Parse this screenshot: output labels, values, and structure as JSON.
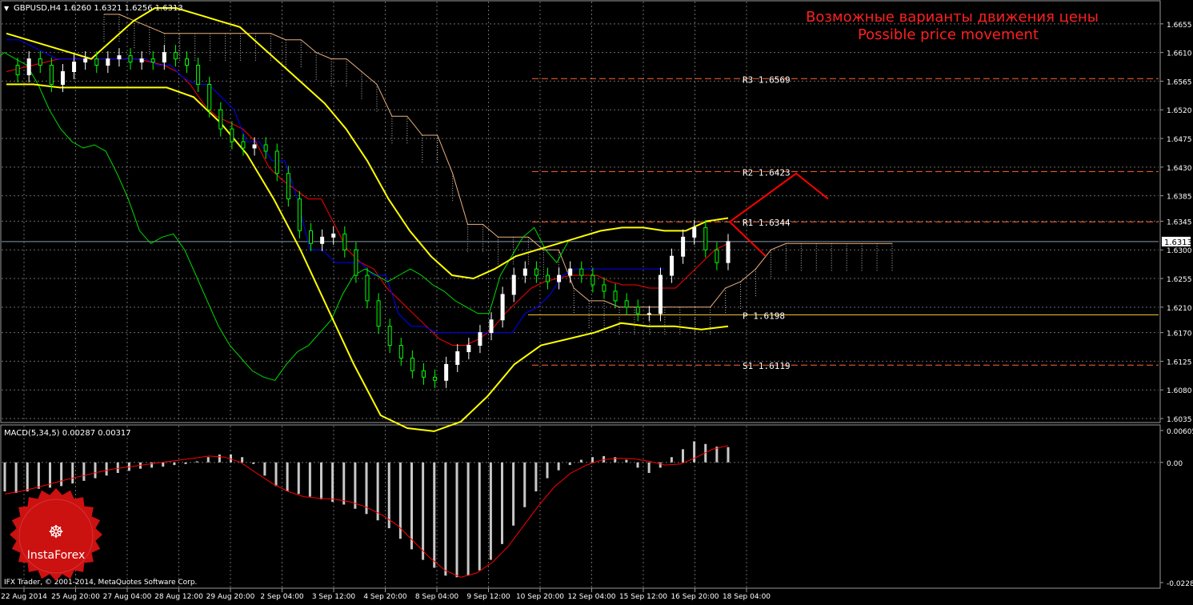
{
  "window": {
    "symbol_header": "GBPUSD,H4  1.6260 1.6321 1.6256 1.6313",
    "menu_arrow": "triangle-down-icon"
  },
  "overlay_title": {
    "ru": "Возможные варианты движения цены",
    "en": "Possible price movement",
    "color": "#ff2020"
  },
  "footer_copyright": "IFX Trader, © 2001-2014, MetaQuotes Software Corp.",
  "logo": {
    "text": "InstaForex",
    "color": "#cc1111"
  },
  "colors": {
    "grid": "#6b6b6b",
    "axis": "#9a9a9a",
    "label": "#ffffff",
    "candle_up": "#ffffff",
    "candle_down": "#00ff00",
    "tenkan": "#ff0000",
    "kijun": "#0000ff",
    "chikou": "#00dd00",
    "bollinger": "#ffff00",
    "level_line": "#ff6633",
    "pivot_line": "#ffcc33",
    "arrow": "#ff0000",
    "histogram": "#c8c8c8",
    "signal": "#ff0000"
  },
  "chart_data": [
    {
      "type": "candlestick",
      "title": "GBPUSD,H4",
      "current_price": "1.6313",
      "y_ticks": [
        "1.6655",
        "1.6610",
        "1.6565",
        "1.6520",
        "1.6475",
        "1.6430",
        "1.6385",
        "1.6345",
        "1.6300",
        "1.6255",
        "1.6210",
        "1.6170",
        "1.6125",
        "1.6080",
        "1.6035"
      ],
      "ylim": [
        1.603,
        1.669
      ],
      "x_ticks": [
        "22 Aug 2014",
        "25 Aug 20:00",
        "27 Aug 04:00",
        "28 Aug 12:00",
        "29 Aug 20:00",
        "2 Sep 04:00",
        "3 Sep 12:00",
        "4 Sep 20:00",
        "8 Sep 04:00",
        "9 Sep 12:00",
        "10 Sep 20:00",
        "12 Sep 04:00",
        "15 Sep 12:00",
        "16 Sep 20:00",
        "18 Sep 04:00"
      ],
      "levels": [
        {
          "label": "R3 1.6569",
          "value": 1.6569,
          "kind": "resistance"
        },
        {
          "label": "R2 1.6423",
          "value": 1.6423,
          "kind": "resistance"
        },
        {
          "label": "R1 1.6344",
          "value": 1.6344,
          "kind": "resistance"
        },
        {
          "label": "P 1.6198",
          "value": 1.6198,
          "kind": "pivot"
        },
        {
          "label": "S1 1.6119",
          "value": 1.6119,
          "kind": "support"
        }
      ],
      "close_series": [
        1.659,
        1.6575,
        1.66,
        1.659,
        1.656,
        1.658,
        1.6595,
        1.66,
        1.659,
        1.66,
        1.6605,
        1.6595,
        1.66,
        1.6595,
        1.661,
        1.66,
        1.659,
        1.656,
        1.652,
        1.649,
        1.647,
        1.646,
        1.6465,
        1.6455,
        1.642,
        1.638,
        1.633,
        1.631,
        1.632,
        1.6325,
        1.63,
        1.626,
        1.622,
        1.618,
        1.615,
        1.613,
        1.611,
        1.61,
        1.6095,
        1.612,
        1.614,
        1.615,
        1.617,
        1.619,
        1.623,
        1.626,
        1.627,
        1.626,
        1.625,
        1.626,
        1.627,
        1.626,
        1.6245,
        1.6235,
        1.622,
        1.621,
        1.62,
        1.62,
        1.626,
        1.629,
        1.632,
        1.6335,
        1.63,
        1.628,
        1.6313
      ],
      "tenkan": [
        1.658,
        1.6585,
        1.659,
        1.6595,
        1.66,
        1.66,
        1.66,
        1.66,
        1.66,
        1.66,
        1.66,
        1.6595,
        1.659,
        1.658,
        1.656,
        1.653,
        1.651,
        1.65,
        1.649,
        1.647,
        1.643,
        1.641,
        1.6395,
        1.638,
        1.638,
        1.634,
        1.63,
        1.628,
        1.627,
        1.624,
        1.622,
        1.62,
        1.618,
        1.616,
        1.615,
        1.615,
        1.616,
        1.6175,
        1.62,
        1.622,
        1.624,
        1.625,
        1.6255,
        1.626,
        1.626,
        1.626,
        1.625,
        1.6245,
        1.6245,
        1.624,
        1.624,
        1.624,
        1.626,
        1.628,
        1.63,
        1.631
      ],
      "kijun": [
        1.663,
        1.663,
        1.662,
        1.661,
        1.66,
        1.66,
        1.66,
        1.66,
        1.66,
        1.66,
        1.66,
        1.66,
        1.659,
        1.659,
        1.657,
        1.656,
        1.656,
        1.654,
        1.652,
        1.647,
        1.647,
        1.644,
        1.644,
        1.638,
        1.63,
        1.63,
        1.628,
        1.628,
        1.628,
        1.626,
        1.626,
        1.62,
        1.618,
        1.618,
        1.617,
        1.617,
        1.617,
        1.617,
        1.617,
        1.617,
        1.617,
        1.62,
        1.621,
        1.623,
        1.626,
        1.627,
        1.627,
        1.627,
        1.627,
        1.627,
        1.627,
        1.627,
        1.627
      ],
      "bollinger_upper": [
        1.664,
        1.663,
        1.662,
        1.661,
        1.66,
        1.663,
        1.666,
        1.668,
        1.668,
        1.667,
        1.666,
        1.665,
        1.662,
        1.659,
        1.656,
        1.653,
        1.649,
        1.644,
        1.638,
        1.633,
        1.629,
        1.626,
        1.6255,
        1.627,
        1.629,
        1.63,
        1.631,
        1.632,
        1.633,
        1.6335,
        1.6335,
        1.633,
        1.633,
        1.6345,
        1.635
      ],
      "bollinger_lower": [
        1.656,
        1.656,
        1.6555,
        1.6555,
        1.6555,
        1.6555,
        1.6555,
        1.654,
        1.65,
        1.645,
        1.638,
        1.63,
        1.621,
        1.612,
        1.604,
        1.602,
        1.6015,
        1.603,
        1.607,
        1.612,
        1.615,
        1.616,
        1.617,
        1.6185,
        1.618,
        1.618,
        1.6175,
        1.618
      ]
    },
    {
      "type": "histogram",
      "title": "MACD(5,34,5) 0.00287 0.00317",
      "y_ticks": [
        "0.00605",
        "0.00",
        "-0.02282"
      ],
      "ylim": [
        -0.02282,
        0.00605
      ],
      "values": [
        -0.0055,
        -0.0058,
        -0.0055,
        -0.005,
        -0.0048,
        -0.0045,
        -0.004,
        -0.0035,
        -0.003,
        -0.0025,
        -0.002,
        -0.0016,
        -0.0012,
        -0.001,
        -0.0008,
        -0.0005,
        -0.0003,
        0.0002,
        0.001,
        0.0015,
        0.0015,
        0.001,
        -0.0003,
        -0.0025,
        -0.0045,
        -0.0055,
        -0.006,
        -0.0065,
        -0.007,
        -0.0075,
        -0.008,
        -0.0088,
        -0.0098,
        -0.011,
        -0.0125,
        -0.0145,
        -0.0165,
        -0.0185,
        -0.02,
        -0.0215,
        -0.0218,
        -0.0215,
        -0.0205,
        -0.0185,
        -0.0155,
        -0.012,
        -0.0085,
        -0.0055,
        -0.003,
        -0.0015,
        -0.0005,
        0.0005,
        0.001,
        0.0012,
        0.001,
        0.0005,
        -0.001,
        -0.002,
        -0.001,
        0.001,
        0.0025,
        0.004,
        0.0035,
        0.003,
        0.0029
      ],
      "signal": [
        -0.006,
        -0.0055,
        -0.0048,
        -0.004,
        -0.0032,
        -0.0025,
        -0.0018,
        -0.0012,
        -0.0008,
        -0.0004,
        0.0,
        0.0004,
        0.0008,
        0.0012,
        0.001,
        0.0,
        -0.002,
        -0.004,
        -0.0055,
        -0.0065,
        -0.0068,
        -0.007,
        -0.0075,
        -0.0085,
        -0.01,
        -0.012,
        -0.015,
        -0.018,
        -0.0205,
        -0.0218,
        -0.021,
        -0.019,
        -0.016,
        -0.012,
        -0.008,
        -0.0045,
        -0.002,
        -0.0005,
        0.0005,
        0.0008,
        0.0007,
        0.0002,
        -0.0005,
        -0.0003,
        0.001,
        0.0025,
        0.0032
      ]
    }
  ]
}
